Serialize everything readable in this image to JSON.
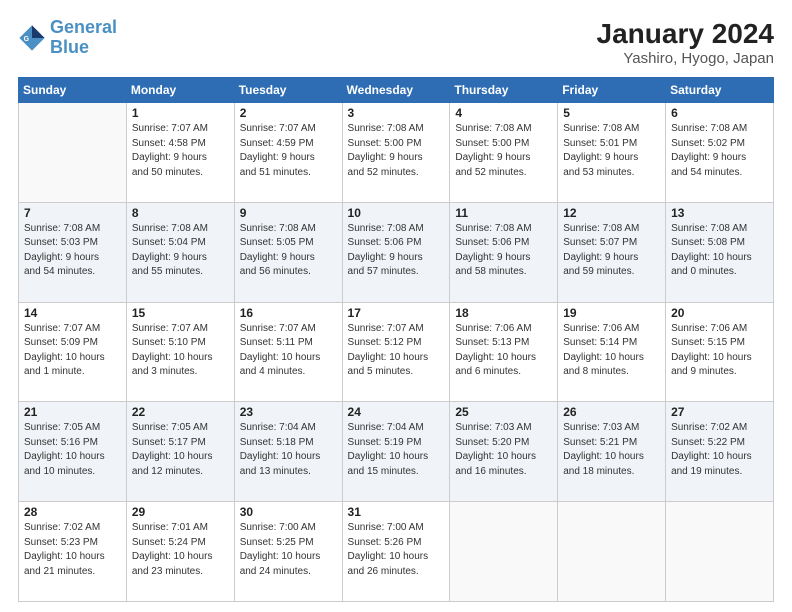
{
  "logo": {
    "line1": "General",
    "line2": "Blue"
  },
  "title": "January 2024",
  "subtitle": "Yashiro, Hyogo, Japan",
  "weekdays": [
    "Sunday",
    "Monday",
    "Tuesday",
    "Wednesday",
    "Thursday",
    "Friday",
    "Saturday"
  ],
  "weeks": [
    [
      {
        "day": "",
        "info": ""
      },
      {
        "day": "1",
        "info": "Sunrise: 7:07 AM\nSunset: 4:58 PM\nDaylight: 9 hours\nand 50 minutes."
      },
      {
        "day": "2",
        "info": "Sunrise: 7:07 AM\nSunset: 4:59 PM\nDaylight: 9 hours\nand 51 minutes."
      },
      {
        "day": "3",
        "info": "Sunrise: 7:08 AM\nSunset: 5:00 PM\nDaylight: 9 hours\nand 52 minutes."
      },
      {
        "day": "4",
        "info": "Sunrise: 7:08 AM\nSunset: 5:00 PM\nDaylight: 9 hours\nand 52 minutes."
      },
      {
        "day": "5",
        "info": "Sunrise: 7:08 AM\nSunset: 5:01 PM\nDaylight: 9 hours\nand 53 minutes."
      },
      {
        "day": "6",
        "info": "Sunrise: 7:08 AM\nSunset: 5:02 PM\nDaylight: 9 hours\nand 54 minutes."
      }
    ],
    [
      {
        "day": "7",
        "info": "Sunrise: 7:08 AM\nSunset: 5:03 PM\nDaylight: 9 hours\nand 54 minutes."
      },
      {
        "day": "8",
        "info": "Sunrise: 7:08 AM\nSunset: 5:04 PM\nDaylight: 9 hours\nand 55 minutes."
      },
      {
        "day": "9",
        "info": "Sunrise: 7:08 AM\nSunset: 5:05 PM\nDaylight: 9 hours\nand 56 minutes."
      },
      {
        "day": "10",
        "info": "Sunrise: 7:08 AM\nSunset: 5:06 PM\nDaylight: 9 hours\nand 57 minutes."
      },
      {
        "day": "11",
        "info": "Sunrise: 7:08 AM\nSunset: 5:06 PM\nDaylight: 9 hours\nand 58 minutes."
      },
      {
        "day": "12",
        "info": "Sunrise: 7:08 AM\nSunset: 5:07 PM\nDaylight: 9 hours\nand 59 minutes."
      },
      {
        "day": "13",
        "info": "Sunrise: 7:08 AM\nSunset: 5:08 PM\nDaylight: 10 hours\nand 0 minutes."
      }
    ],
    [
      {
        "day": "14",
        "info": "Sunrise: 7:07 AM\nSunset: 5:09 PM\nDaylight: 10 hours\nand 1 minute."
      },
      {
        "day": "15",
        "info": "Sunrise: 7:07 AM\nSunset: 5:10 PM\nDaylight: 10 hours\nand 3 minutes."
      },
      {
        "day": "16",
        "info": "Sunrise: 7:07 AM\nSunset: 5:11 PM\nDaylight: 10 hours\nand 4 minutes."
      },
      {
        "day": "17",
        "info": "Sunrise: 7:07 AM\nSunset: 5:12 PM\nDaylight: 10 hours\nand 5 minutes."
      },
      {
        "day": "18",
        "info": "Sunrise: 7:06 AM\nSunset: 5:13 PM\nDaylight: 10 hours\nand 6 minutes."
      },
      {
        "day": "19",
        "info": "Sunrise: 7:06 AM\nSunset: 5:14 PM\nDaylight: 10 hours\nand 8 minutes."
      },
      {
        "day": "20",
        "info": "Sunrise: 7:06 AM\nSunset: 5:15 PM\nDaylight: 10 hours\nand 9 minutes."
      }
    ],
    [
      {
        "day": "21",
        "info": "Sunrise: 7:05 AM\nSunset: 5:16 PM\nDaylight: 10 hours\nand 10 minutes."
      },
      {
        "day": "22",
        "info": "Sunrise: 7:05 AM\nSunset: 5:17 PM\nDaylight: 10 hours\nand 12 minutes."
      },
      {
        "day": "23",
        "info": "Sunrise: 7:04 AM\nSunset: 5:18 PM\nDaylight: 10 hours\nand 13 minutes."
      },
      {
        "day": "24",
        "info": "Sunrise: 7:04 AM\nSunset: 5:19 PM\nDaylight: 10 hours\nand 15 minutes."
      },
      {
        "day": "25",
        "info": "Sunrise: 7:03 AM\nSunset: 5:20 PM\nDaylight: 10 hours\nand 16 minutes."
      },
      {
        "day": "26",
        "info": "Sunrise: 7:03 AM\nSunset: 5:21 PM\nDaylight: 10 hours\nand 18 minutes."
      },
      {
        "day": "27",
        "info": "Sunrise: 7:02 AM\nSunset: 5:22 PM\nDaylight: 10 hours\nand 19 minutes."
      }
    ],
    [
      {
        "day": "28",
        "info": "Sunrise: 7:02 AM\nSunset: 5:23 PM\nDaylight: 10 hours\nand 21 minutes."
      },
      {
        "day": "29",
        "info": "Sunrise: 7:01 AM\nSunset: 5:24 PM\nDaylight: 10 hours\nand 23 minutes."
      },
      {
        "day": "30",
        "info": "Sunrise: 7:00 AM\nSunset: 5:25 PM\nDaylight: 10 hours\nand 24 minutes."
      },
      {
        "day": "31",
        "info": "Sunrise: 7:00 AM\nSunset: 5:26 PM\nDaylight: 10 hours\nand 26 minutes."
      },
      {
        "day": "",
        "info": ""
      },
      {
        "day": "",
        "info": ""
      },
      {
        "day": "",
        "info": ""
      }
    ]
  ]
}
